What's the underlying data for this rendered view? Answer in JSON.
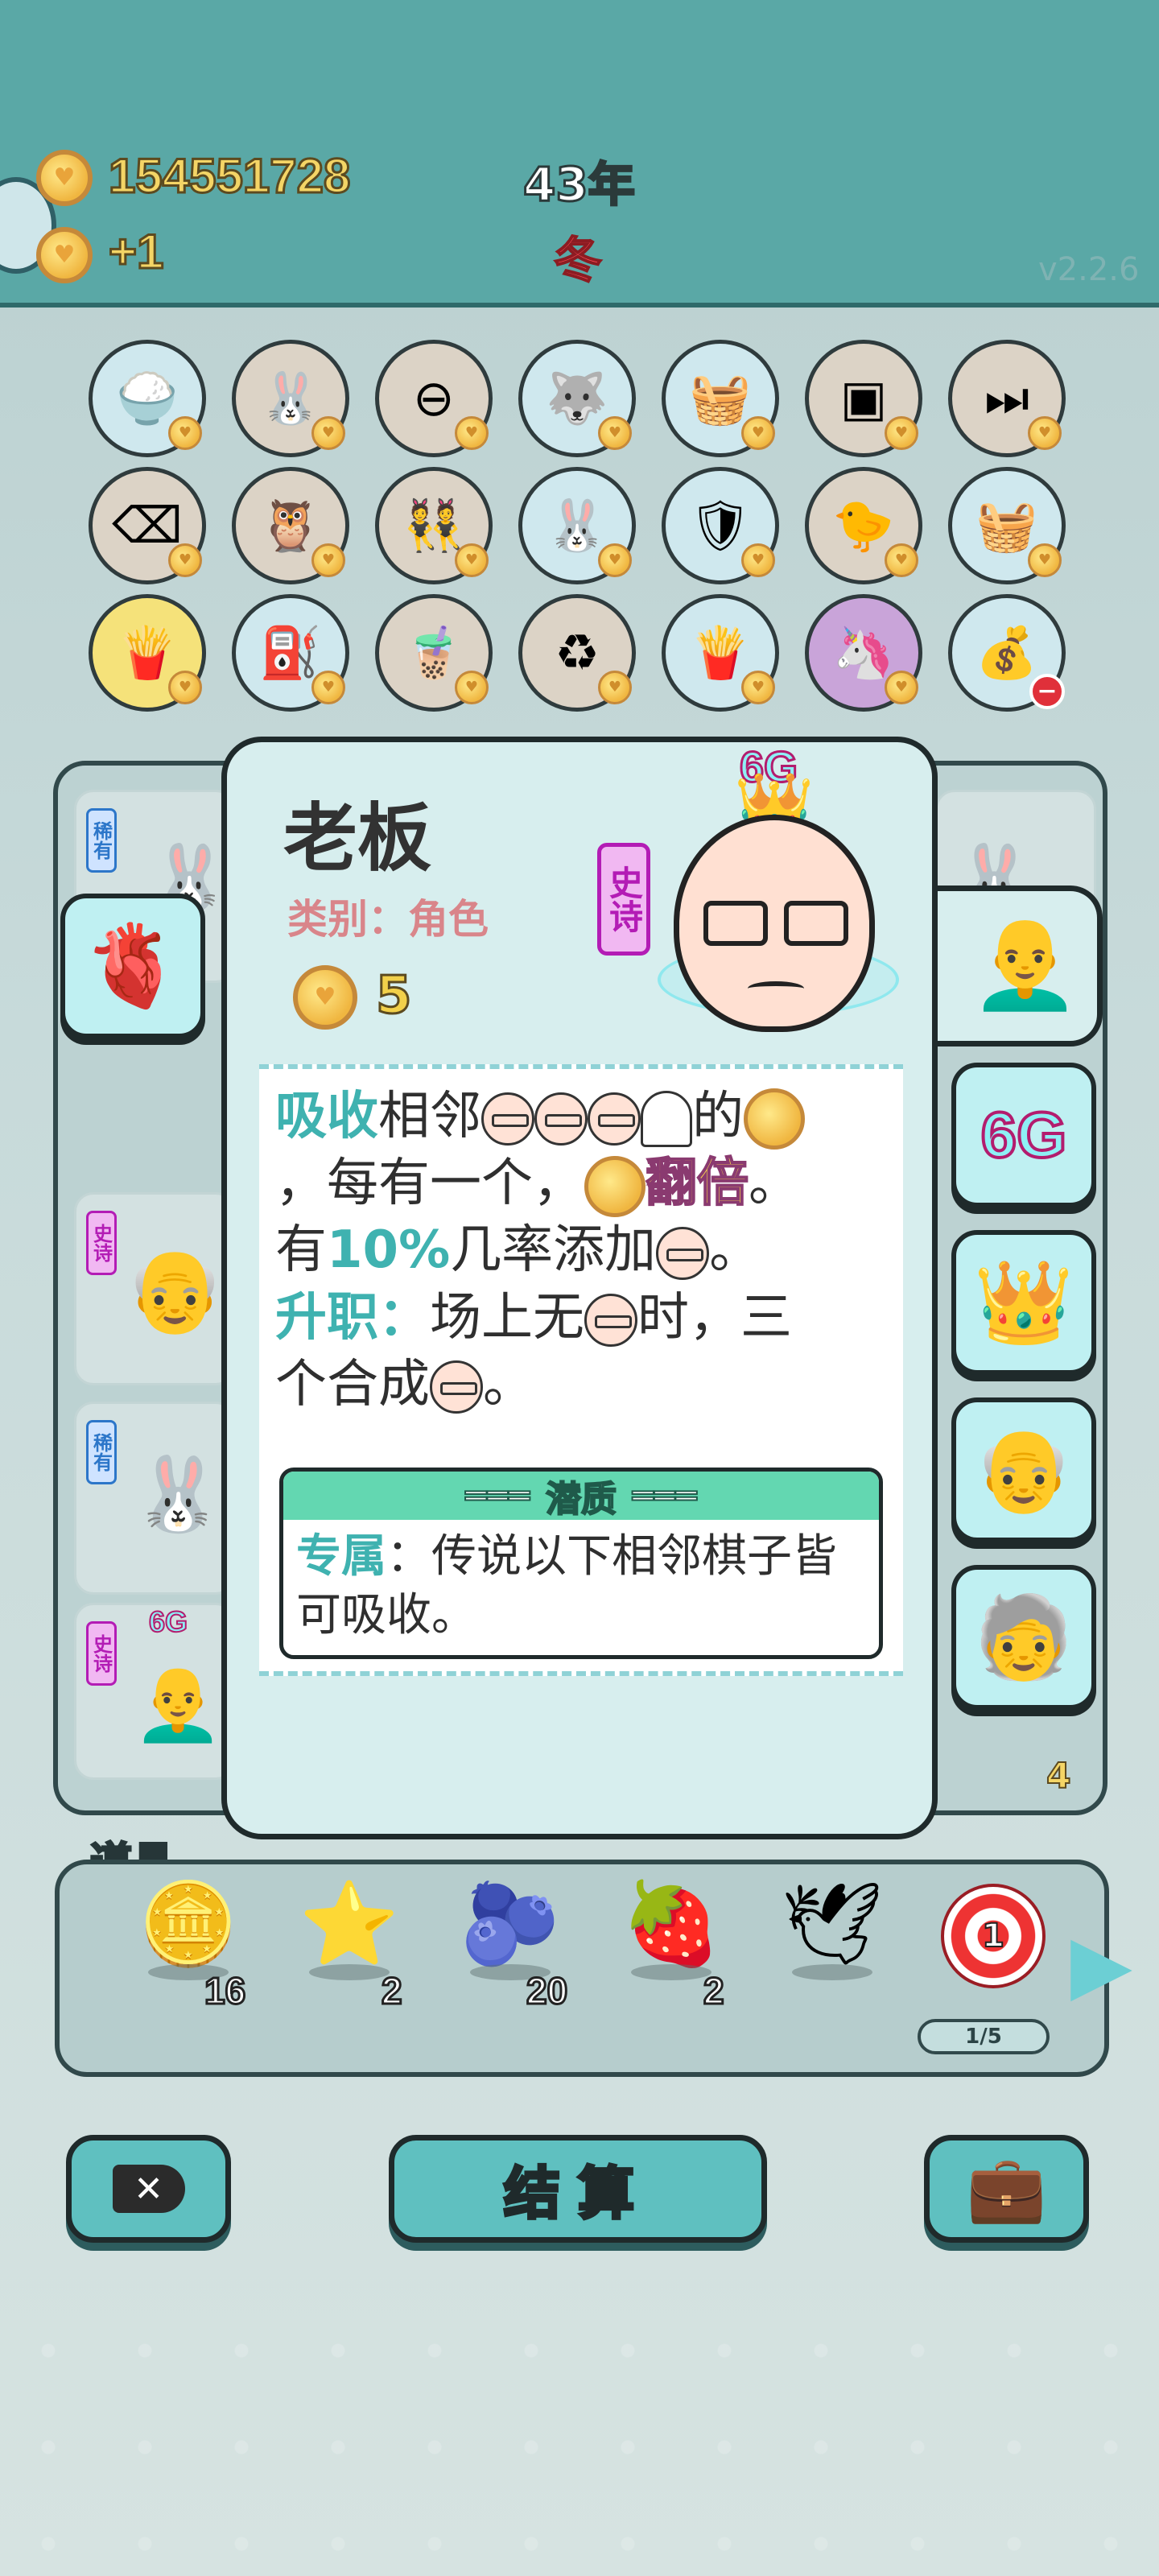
{
  "header": {
    "coins": "154551728",
    "income": "+1",
    "year": "43年",
    "season": "冬",
    "version": "v2.2.6"
  },
  "item_grid": [
    [
      "rice-bowl-icon",
      "bunny-icon",
      "no-entry-icon",
      "husky-icon",
      "fruit-basket-icon",
      "cubes-icon",
      "skip-icon"
    ],
    [
      "delete-tag-icon",
      "owl-pair-icon",
      "twins-icon",
      "bunny-icon",
      "shield-wrench-icon",
      "chick-egg-icon",
      "fruit-basket-icon"
    ],
    [
      "fries-icon",
      "pump-icon",
      "bubble-tea-icon",
      "recycle-icon",
      "fries-icon",
      "unicorn-twins-icon",
      "sack-icon"
    ]
  ],
  "board": {
    "left_tags": [
      "稀有",
      "史诗",
      "稀有",
      "史诗"
    ],
    "left_sign": "",
    "left_6g": "6G",
    "right_count": "4"
  },
  "detail": {
    "name": "老板",
    "category_label": "类别：",
    "category_value": "角色",
    "cost": "5",
    "rarity": "史诗",
    "tag_6g": "6G",
    "desc": {
      "absorb_key": "吸收",
      "absorb_rest1": "相邻",
      "absorb_rest2": "的",
      "line2_a": "，每有一个，",
      "double": "翻倍",
      "line2_end": "。",
      "line3_a": "有",
      "line3_pct": "10%",
      "line3_b": "几率添加",
      "line3_end": "。",
      "promote_key": "升职：",
      "promote_rest1": "场上无",
      "promote_rest2": "时，三",
      "line5_a": "个合成",
      "line5_end": "。"
    },
    "trait": {
      "header": "潜质",
      "key": "专属",
      "text1": "：传说以下相邻棋子皆",
      "text2": "可吸收。"
    }
  },
  "side_cards": [
    "liver-icon",
    "boss-face-icon",
    "6G",
    "crown-icon",
    "bald-grandpa-icon",
    "grandpa-glasses-icon"
  ],
  "tools": {
    "label": "道具",
    "items": [
      {
        "icon": "dollar-coin-icon",
        "count": "16"
      },
      {
        "icon": "star-icon",
        "count": "2"
      },
      {
        "icon": "blueberry-icon",
        "count": "20"
      },
      {
        "icon": "strawberry-icon",
        "count": "2"
      },
      {
        "icon": "dove-icon",
        "count": ""
      },
      {
        "icon": "dartboard-icon",
        "count": "1"
      }
    ],
    "progress": "1/5"
  },
  "buttons": {
    "settle": "结算"
  },
  "colors": {
    "top_bar": "#5aa8a6",
    "panel": "#d7eeee",
    "highlight_teal": "#3fb2b0",
    "epic": "#b31cb5"
  }
}
